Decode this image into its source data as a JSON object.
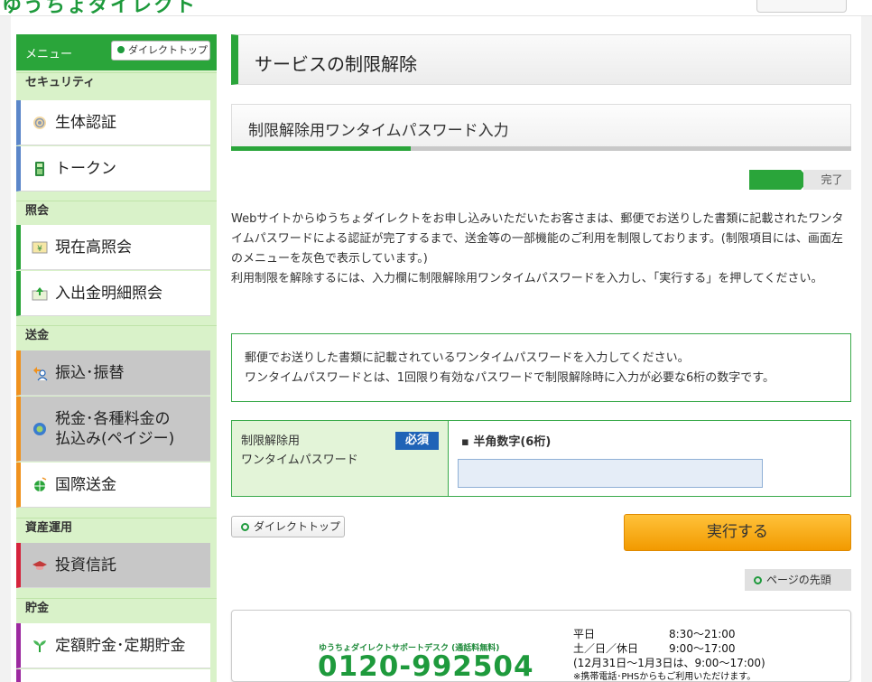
{
  "sidebar": {
    "menu_title": "メニュー",
    "direct_top_label": "ダイレクトトップ",
    "categories": {
      "security": "セキュリティ",
      "inquiry": "照会",
      "transfer": "送金",
      "asset": "資産運用",
      "savings": "貯金"
    },
    "items": {
      "biometric": "生体認証",
      "token": "トークン",
      "balance": "現在高照会",
      "statement": "入出金明細照会",
      "furikomi": "振込･振替",
      "tax_line1": "税金･各種料金の",
      "tax_line2": "払込み(ペイジー)",
      "intl": "国際送金",
      "fund": "投資信託",
      "teigaku": "定額貯金･定期貯金"
    }
  },
  "main": {
    "title": "サービスの制限解除",
    "subtitle": "制限解除用ワンタイムパスワード入力",
    "progress": 0.29,
    "step_done_label": "完了",
    "desc1": "Webサイトからゆうちょダイレクトをお申し込みいただいたお客さまは、郵便でお送りした書類に記載されたワンタイムパスワードによる認証が完了するまで、送金等の一部機能のご利用を制限しております。(制限項目には、画面左のメニューを灰色で表示しています。)",
    "desc2": "利用制限を解除するには、入力欄に制限解除用ワンタイムパスワードを入力し、「実行する」を押してください。",
    "notice1": "郵便でお送りした書類に記載されているワンタイムパスワードを入力してください。",
    "notice2": "ワンタイムパスワードとは、1回限り有効なパスワードで制限解除時に入力が必要な6桁の数字です。",
    "form": {
      "label_line1": "制限解除用",
      "label_line2": "ワンタイムパスワード",
      "required": "必須",
      "hint": "▪ 半角数字(6桁)",
      "value": ""
    },
    "direct_top_label": "ダイレクトトップ",
    "exec_label": "実行する",
    "page_top_label": "ページの先頭"
  },
  "support": {
    "desk": "ゆうちょダイレクトサポートデスク (通話料無料)",
    "number": "0120-992504",
    "weekday_label": "平日",
    "weekday_time": "8:30～21:00",
    "weekend_label": "土／日／休日",
    "weekend_time": "9:00～17:00",
    "newyear": "(12月31日～1月3日は、9:00～17:00)",
    "note": "※携帯電話･PHSからもご利用いただけます。"
  },
  "colors": {
    "brand_green": "#2aa53a",
    "button_orange": "#f29a00",
    "required_blue": "#1f63b7"
  }
}
